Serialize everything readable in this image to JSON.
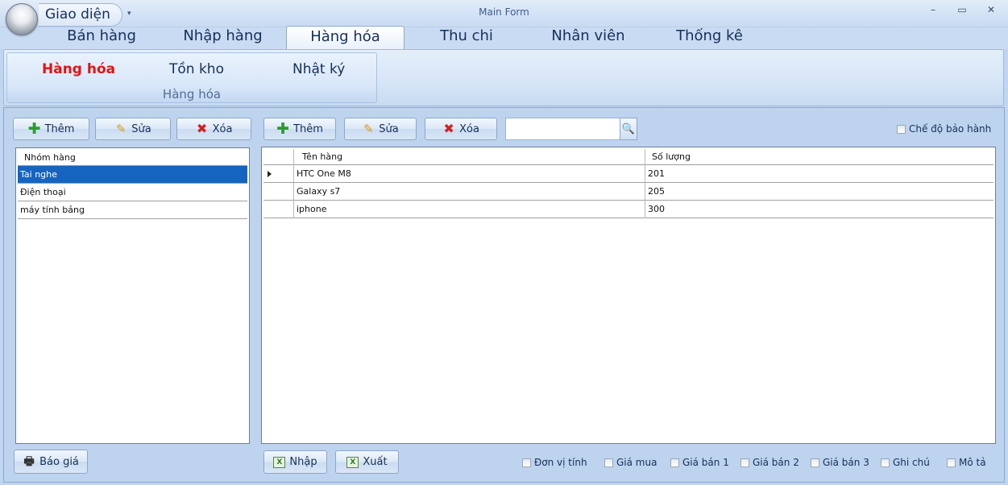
{
  "window": {
    "title": "Main Form",
    "app_menu": "Giao diện",
    "qat": "▾",
    "minimize": "–",
    "maximize": "▭",
    "close": "✕"
  },
  "tabs": [
    "Bán hàng",
    "Nhập hàng",
    "Hàng hóa",
    "Thu chi",
    "Nhân viên",
    "Thống kê"
  ],
  "active_tab": "Hàng hóa",
  "ribbon": {
    "group_label": "Hàng hóa",
    "buttons": [
      "Hàng hóa",
      "Tồn kho",
      "Nhật ký"
    ],
    "active_button": "Hàng hóa"
  },
  "left_toolbar": {
    "add": "Thêm",
    "edit": "Sửa",
    "delete": "Xóa"
  },
  "right_toolbar": {
    "add": "Thêm",
    "edit": "Sửa",
    "delete": "Xóa"
  },
  "search": {
    "value": "",
    "placeholder": ""
  },
  "warranty_mode": {
    "label": "Chế độ bảo hành",
    "checked": false
  },
  "groups_grid": {
    "header": "Nhóm hàng",
    "rows": [
      "Tai nghe",
      "Điện thoại",
      "máy tính bảng"
    ],
    "selected_index": 0
  },
  "products_grid": {
    "columns": [
      "Tên hàng",
      "Số lượng"
    ],
    "rows": [
      [
        "HTC One M8",
        "201"
      ],
      [
        "Galaxy s7",
        "205"
      ],
      [
        "iphone",
        "300"
      ]
    ],
    "current_row": 0
  },
  "bottom": {
    "quote": "Báo giá",
    "import": "Nhập",
    "export": "Xuất",
    "column_toggles": [
      "Đơn vị tính",
      "Giá mua",
      "Giá bán 1",
      "Giá bán 2",
      "Giá bán 3",
      "Ghi chú",
      "Mô tả"
    ]
  },
  "colors": {
    "accent_red": "#e01414",
    "selection": "#1565c0",
    "chrome": "#bed3ee"
  }
}
